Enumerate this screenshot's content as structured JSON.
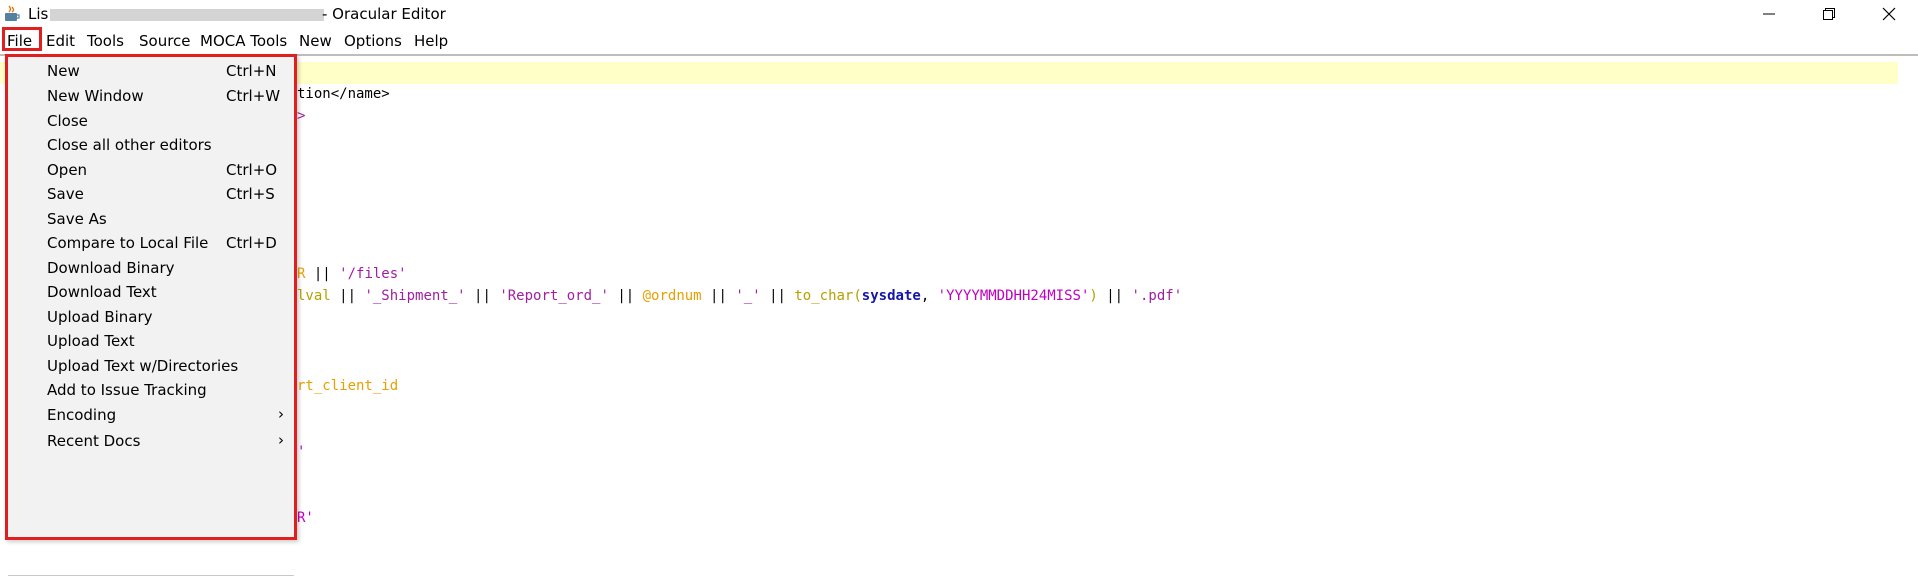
{
  "window": {
    "title_prefix": "Lis",
    "title_suffix": "- Oracular Editor",
    "controls": [
      "minimize",
      "restore",
      "close"
    ]
  },
  "menubar": {
    "items": [
      "File",
      "Edit",
      "Tools",
      "Source",
      "MOCA Tools",
      "New",
      "Options",
      "Help"
    ]
  },
  "editor": {
    "lines": [
      {
        "segments": [
          {
            "text": "tion</name>",
            "color": "black"
          }
        ]
      },
      {
        "segments": [
          {
            "text": ">",
            "color": "purple"
          }
        ]
      },
      {
        "segments": [
          {
            "text": "R",
            "color": "orange"
          },
          {
            "text": " || ",
            "color": "black"
          },
          {
            "text": "'/files'",
            "color": "purple"
          }
        ]
      },
      {
        "segments": [
          {
            "text": "lval",
            "color": "olive"
          },
          {
            "text": " || ",
            "color": "black"
          },
          {
            "text": "'_Shipment_'",
            "color": "purple"
          },
          {
            "text": " || ",
            "color": "black"
          },
          {
            "text": "'Report_ord_'",
            "color": "purple"
          },
          {
            "text": " || ",
            "color": "black"
          },
          {
            "text": "@ordnum",
            "color": "orange"
          },
          {
            "text": " || ",
            "color": "black"
          },
          {
            "text": "'_'",
            "color": "purple"
          },
          {
            "text": " || ",
            "color": "black"
          },
          {
            "text": "to_char(",
            "color": "olive"
          },
          {
            "text": "sysdate",
            "color": "blue"
          },
          {
            "text": ", ",
            "color": "black"
          },
          {
            "text": "'YYYYMMDDHH24MISS'",
            "color": "magenta"
          },
          {
            "text": ")",
            "color": "olive"
          },
          {
            "text": " || ",
            "color": "black"
          },
          {
            "text": "'.pdf'",
            "color": "purple"
          }
        ]
      },
      {
        "segments": [
          {
            "text": "rt_client_id",
            "color": "orange"
          }
        ]
      },
      {
        "segments": [
          {
            "text": "'",
            "color": "magenta"
          }
        ]
      },
      {
        "segments": [
          {
            "text": "R'",
            "color": "magenta"
          }
        ]
      }
    ]
  },
  "file_menu": {
    "items": [
      {
        "label": "New",
        "accel": "Ctrl+N"
      },
      {
        "label": "New Window",
        "accel": "Ctrl+W"
      },
      {
        "label": "Close",
        "accel": ""
      },
      {
        "label": "Close all other editors",
        "accel": ""
      },
      {
        "label": "Open",
        "accel": "Ctrl+O"
      },
      {
        "label": "Save",
        "accel": "Ctrl+S"
      },
      {
        "label": "Save As",
        "accel": ""
      },
      {
        "label": "Compare to Local File",
        "accel": "Ctrl+D"
      },
      {
        "label": "Download Binary",
        "accel": ""
      },
      {
        "label": "Download Text",
        "accel": ""
      },
      {
        "label": "Upload Binary",
        "accel": ""
      },
      {
        "label": "Upload Text",
        "accel": ""
      },
      {
        "label": "Upload Text w/Directories",
        "accel": ""
      },
      {
        "label": "Add to Issue Tracking",
        "accel": ""
      },
      {
        "label": "Encoding",
        "accel": "",
        "submenu": true
      },
      {
        "label": "Recent Docs",
        "accel": "",
        "submenu": true
      }
    ],
    "submenu_arrow": "›"
  },
  "colors": {
    "highlight_border": "#e02020",
    "current_line": "#ffffc8",
    "black": "#000000",
    "purple": "#a020a0",
    "orange": "#e8a000",
    "olive": "#b5a000",
    "blue": "#1515a8",
    "magenta": "#c000c0"
  }
}
